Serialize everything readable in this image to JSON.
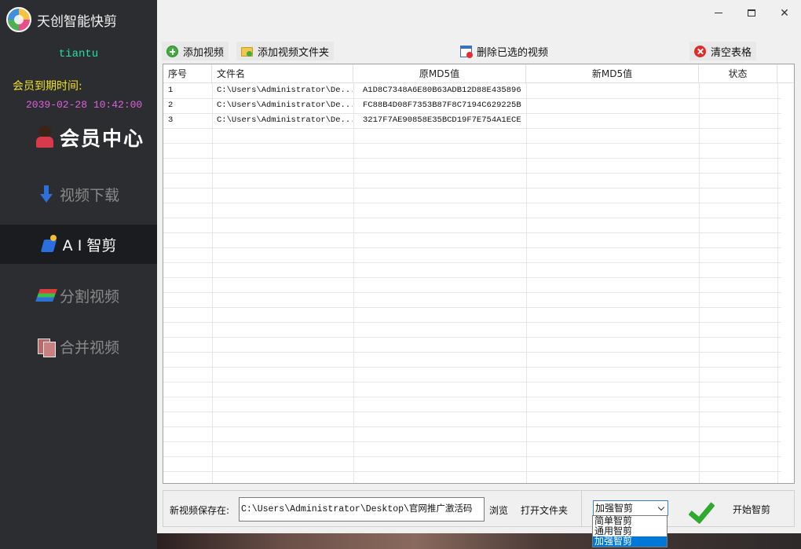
{
  "app": {
    "title": "天创智能快剪"
  },
  "sidebar": {
    "username": "tiantu",
    "expire_label": "会员到期时间:",
    "expire_time": "2039-02-28 10:42:00",
    "member_center": "会员中心",
    "nav": [
      {
        "label": "视频下载",
        "icon": "download-arrow-icon",
        "active": false
      },
      {
        "label": "A I 智剪",
        "icon": "ai-cut-icon",
        "active": true
      },
      {
        "label": "分割视频",
        "icon": "split-video-icon",
        "active": false
      },
      {
        "label": "合并视频",
        "icon": "merge-video-icon",
        "active": false
      }
    ]
  },
  "window": {
    "minimize": "minimize",
    "maximize": "maximize",
    "close": "✕"
  },
  "toolbar": {
    "add_video": "添加视频",
    "add_folder": "添加视频文件夹",
    "delete_selected": "删除已选的视频",
    "clear_table": "清空表格"
  },
  "table": {
    "columns": [
      "序号",
      "文件名",
      "原MD5值",
      "新MD5值",
      "状态"
    ],
    "rows": [
      {
        "idx": "1",
        "file": "C:\\Users\\Administrator\\De...",
        "md5": "A1D8C7348A6E80B63ADB12D88E435896",
        "new_md5": "",
        "status": ""
      },
      {
        "idx": "2",
        "file": "C:\\Users\\Administrator\\De...",
        "md5": "FC88B4D08F7353B87F8C7194C629225B",
        "new_md5": "",
        "status": ""
      },
      {
        "idx": "3",
        "file": "C:\\Users\\Administrator\\De...",
        "md5": "3217F7AE90858E35BCD19F7E754A1ECE",
        "new_md5": "",
        "status": ""
      }
    ]
  },
  "save": {
    "label": "新视频保存在:",
    "path": "C:\\Users\\Administrator\\Desktop\\官网推广激活码",
    "browse": "浏览",
    "open_folder": "打开文件夹"
  },
  "mode": {
    "selected": "加强智剪",
    "options": [
      "简单智剪",
      "通用智剪",
      "加强智剪"
    ],
    "start": "开始智剪"
  }
}
